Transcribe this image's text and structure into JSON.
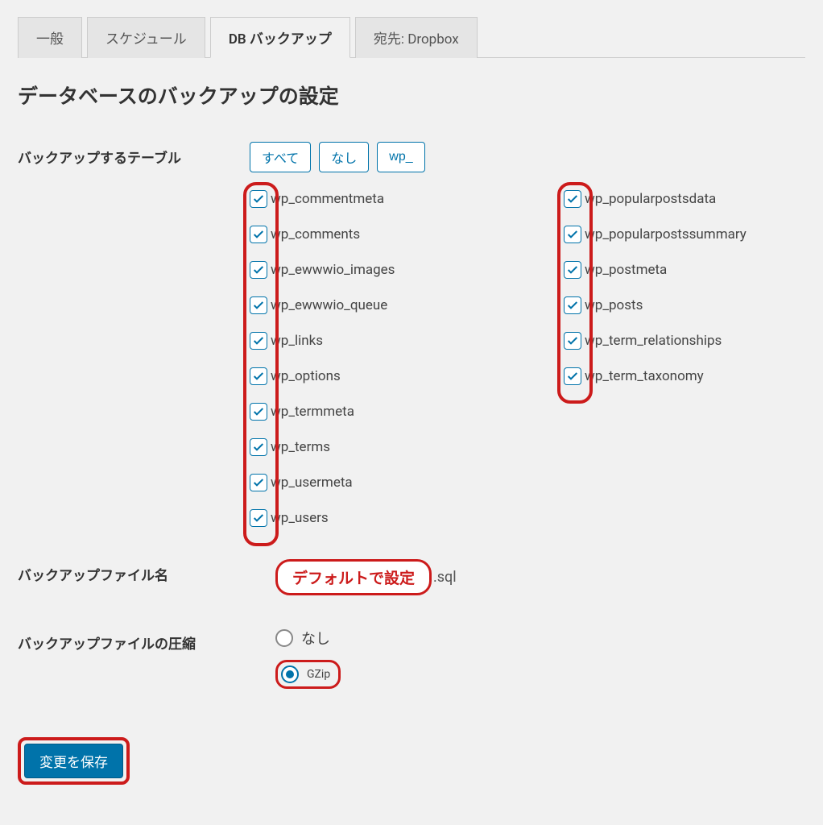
{
  "tabs": [
    {
      "label": "一般",
      "active": false
    },
    {
      "label": "スケジュール",
      "active": false
    },
    {
      "label": "DB バックアップ",
      "active": true
    },
    {
      "label": "宛先: Dropbox",
      "active": false
    }
  ],
  "section_title": "データベースのバックアップの設定",
  "labels": {
    "tables": "バックアップするテーブル",
    "filename": "バックアップファイル名",
    "compression": "バックアップファイルの圧縮"
  },
  "filter_buttons": {
    "all": "すべて",
    "none": "なし",
    "wp": "wp_"
  },
  "tables_col1": [
    "wp_commentmeta",
    "wp_comments",
    "wp_ewwwio_images",
    "wp_ewwwio_queue",
    "wp_links",
    "wp_options",
    "wp_termmeta",
    "wp_terms",
    "wp_usermeta",
    "wp_users"
  ],
  "tables_col2": [
    "wp_popularpostsdata",
    "wp_popularpostssummary",
    "wp_postmeta",
    "wp_posts",
    "wp_term_relationships",
    "wp_term_taxonomy"
  ],
  "filename_annotation": "デフォルトで設定",
  "filename_ext": ".sql",
  "compression": {
    "none": "なし",
    "gzip": "GZip",
    "selected": "gzip"
  },
  "save_button": "変更を保存",
  "colors": {
    "accent": "#0073aa",
    "annotation": "#cc1b1b",
    "bg": "#f1f1f1"
  }
}
